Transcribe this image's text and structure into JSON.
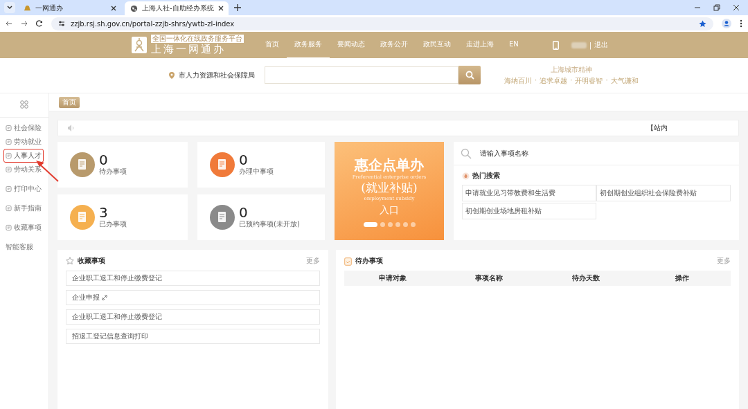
{
  "browser": {
    "tabs": [
      {
        "title": "一网通办",
        "selected": false
      },
      {
        "title": "上海人社-自助经办系统",
        "selected": true
      }
    ],
    "url": "zzjb.rsj.sh.gov.cn/portal-zzjb-shrs/ywtb-zl-index"
  },
  "header": {
    "logo_badge": "全国一体化在线政务服务平台",
    "logo_title": "上海一网通办",
    "nav": [
      {
        "label": "首页",
        "selected": false
      },
      {
        "label": "政务服务",
        "selected": true
      },
      {
        "label": "要闻动态",
        "selected": false
      },
      {
        "label": "政务公开",
        "selected": false
      },
      {
        "label": "政民互动",
        "selected": false
      },
      {
        "label": "走进上海",
        "selected": false
      },
      {
        "label": "EN",
        "selected": false
      }
    ],
    "separator": "|",
    "logout": "退出"
  },
  "searchbar": {
    "location": "市人力资源和社会保障局",
    "spirit_title": "上海城市精神",
    "spirit_items": [
      "海纳百川",
      "追求卓越",
      "开明睿智",
      "大气谦和"
    ],
    "spirit_separator": "·"
  },
  "sidebar": {
    "groups": [
      {
        "items": [
          {
            "label": "社会保险",
            "highlighted": false
          },
          {
            "label": "劳动就业",
            "highlighted": false
          },
          {
            "label": "人事人才",
            "highlighted": true
          },
          {
            "label": "劳动关系",
            "highlighted": false
          }
        ]
      },
      {
        "items": [
          {
            "label": "打印中心",
            "highlighted": false
          }
        ]
      },
      {
        "items": [
          {
            "label": "新手指南",
            "highlighted": false
          }
        ]
      },
      {
        "items": [
          {
            "label": "收藏事项",
            "highlighted": false
          }
        ]
      },
      {
        "items": [
          {
            "label": "智能客服",
            "highlighted": false
          }
        ]
      }
    ]
  },
  "breadcrumb": "首页",
  "notice": {
    "text": "【站内"
  },
  "stats": [
    {
      "count": "0",
      "label": "待办事项",
      "color": "#b89a6c"
    },
    {
      "count": "0",
      "label": "办理中事项",
      "color": "#f07a3a"
    },
    {
      "count": "3",
      "label": "已办事项",
      "color": "#f5b050"
    },
    {
      "count": "0",
      "label": "已预约事项(未开放)",
      "color": "#8a8a8a"
    }
  ],
  "banner": {
    "title": "惠企点单办",
    "subtitle": "Preferential enterprise orders",
    "tag": "(就业补贴)",
    "tag_en": "employment subsidy",
    "entry": "入口",
    "dots": [
      {
        "selected": true
      },
      {
        "selected": false
      },
      {
        "selected": false
      },
      {
        "selected": false
      },
      {
        "selected": false
      },
      {
        "selected": false
      }
    ]
  },
  "search_card": {
    "placeholder": "请输入事项名称",
    "hot_title": "热门搜索",
    "hot_items": [
      "申请就业见习带教费和生活费",
      "初创期创业组织社会保险费补贴",
      "初创期创业场地房租补贴"
    ]
  },
  "favorites": {
    "title": "收藏事项",
    "more": "更多",
    "items": [
      "企业职工退工和停止缴费登记",
      "企业申报",
      "企业职工退工和停止缴费登记",
      "招退工登记信息查询打印"
    ]
  },
  "todo": {
    "title": "待办事项",
    "more": "更多",
    "columns": [
      "申请对象",
      "事项名称",
      "待办天数",
      "操作"
    ]
  }
}
